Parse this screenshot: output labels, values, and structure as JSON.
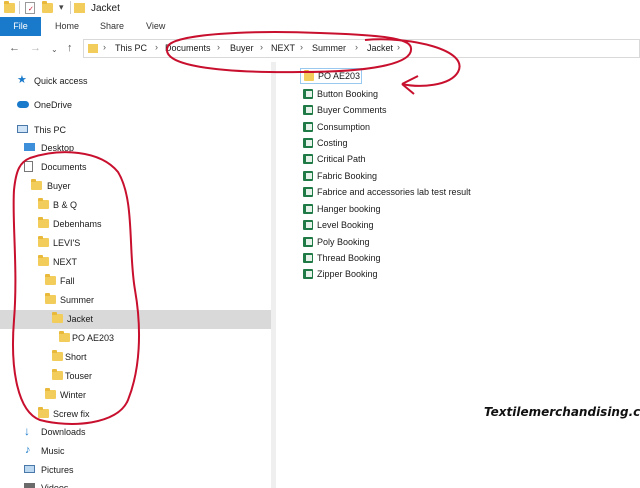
{
  "window": {
    "title": "Jacket"
  },
  "ribbon": {
    "file": "File",
    "tabs": [
      "Home",
      "Share",
      "View"
    ]
  },
  "address": {
    "breadcrumbs": [
      "This PC",
      "Documents",
      "Buyer",
      "NEXT",
      "Summer",
      "Jacket"
    ],
    "separator": "›"
  },
  "nav": {
    "quick_access": "Quick access",
    "onedrive": "OneDrive",
    "this_pc": "This PC",
    "desktop": "Desktop",
    "documents": "Documents",
    "buyer": "Buyer",
    "b_q": "B & Q",
    "debenhams": "Debenhams",
    "levis": "LEVI'S",
    "next": "NEXT",
    "fall": "Fall",
    "summer": "Summer",
    "jacket": "Jacket",
    "po": "PO AE203",
    "short": "Short",
    "touser": "Touser",
    "winter": "Winter",
    "screw_fix": "Screw fix",
    "downloads": "Downloads",
    "music": "Music",
    "pictures": "Pictures",
    "videos": "Videos"
  },
  "files": {
    "folder": "PO AE203",
    "items": [
      "Button Booking",
      "Buyer Comments",
      "Consumption",
      "Costing",
      "Critical Path",
      "Fabric Booking",
      "Fabrice and accessories lab test result",
      "Hanger booking",
      "Level Booking",
      "Poly Booking",
      "Thread Booking",
      "Zipper Booking"
    ]
  },
  "watermark": "Textilemerchandising.com",
  "colors": {
    "accent": "#1979ca",
    "annotation": "#c8102e",
    "folder": "#f3cd5b",
    "excel": "#1f7a45",
    "selected": "#d9d9d9"
  }
}
